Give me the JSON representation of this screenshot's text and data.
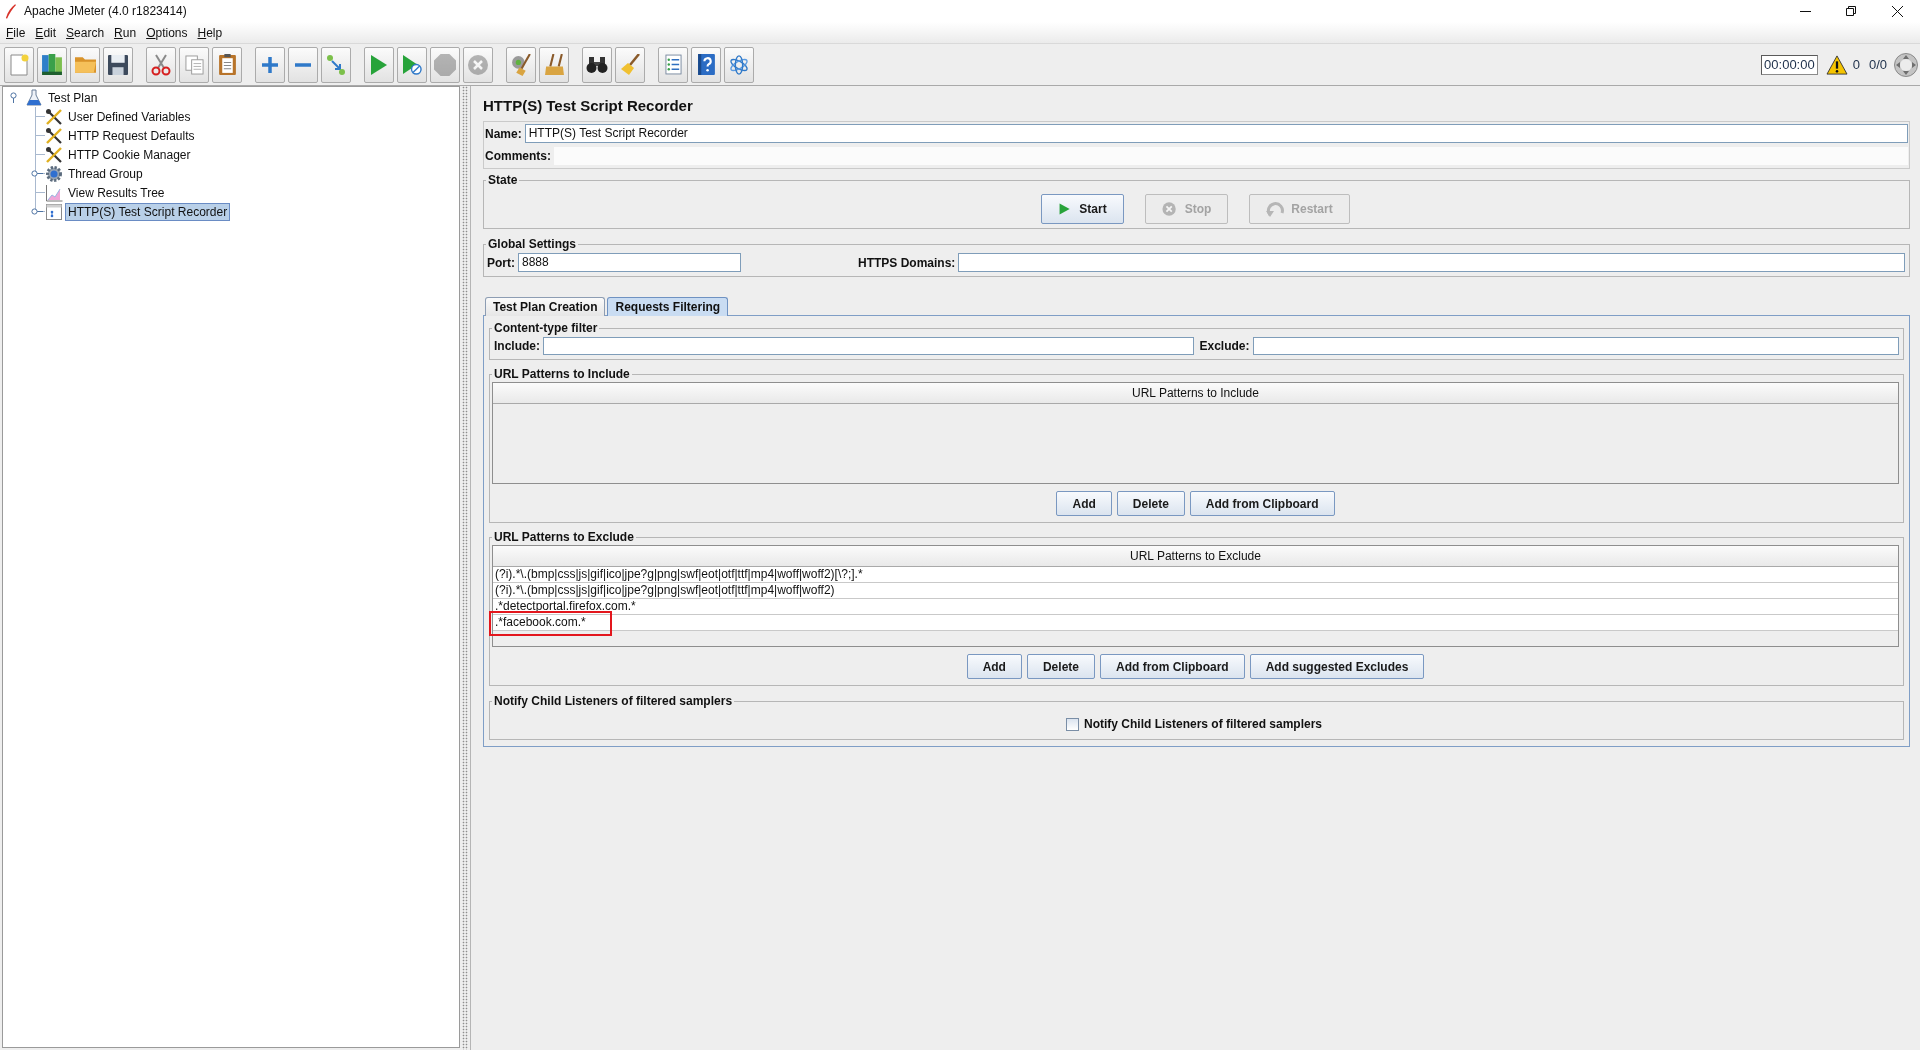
{
  "window": {
    "title": "Apache JMeter (4.0 r1823414)"
  },
  "menu": [
    "File",
    "Edit",
    "Search",
    "Run",
    "Options",
    "Help"
  ],
  "toolbar": {
    "groups": [
      [
        {
          "kind": "new",
          "disabled": false
        },
        {
          "kind": "templates",
          "disabled": false
        },
        {
          "kind": "open",
          "disabled": false
        },
        {
          "kind": "save",
          "disabled": false
        }
      ],
      [
        {
          "kind": "cut",
          "disabled": false
        },
        {
          "kind": "copy",
          "disabled": false
        },
        {
          "kind": "paste",
          "disabled": false
        }
      ],
      [
        {
          "kind": "expand",
          "disabled": false
        },
        {
          "kind": "collapse",
          "disabled": false
        },
        {
          "kind": "toggle",
          "disabled": false
        }
      ],
      [
        {
          "kind": "start",
          "disabled": false
        },
        {
          "kind": "start_no_pauses",
          "disabled": false
        },
        {
          "kind": "stop",
          "disabled": true
        },
        {
          "kind": "shutdown",
          "disabled": true
        }
      ],
      [
        {
          "kind": "clear",
          "disabled": false
        },
        {
          "kind": "clear_all",
          "disabled": false
        }
      ],
      [
        {
          "kind": "search",
          "disabled": false
        },
        {
          "kind": "reset_search",
          "disabled": false
        }
      ],
      [
        {
          "kind": "functions",
          "disabled": false
        },
        {
          "kind": "help",
          "disabled": false
        },
        {
          "kind": "log_viewer",
          "disabled": false
        }
      ]
    ],
    "timer": "00:00:00",
    "error_count": "0",
    "threads": "0/0"
  },
  "tree": {
    "items": [
      {
        "label": "Test Plan",
        "kind": "plan",
        "expanded": true,
        "selected": false,
        "children": [
          {
            "label": "User Defined Variables",
            "kind": "config",
            "selected": false
          },
          {
            "label": "HTTP Request Defaults",
            "kind": "config",
            "selected": false
          },
          {
            "label": "HTTP Cookie Manager",
            "kind": "config",
            "selected": false
          },
          {
            "label": "Thread Group",
            "kind": "thread_group",
            "expanded": false,
            "selected": false
          },
          {
            "label": "View Results Tree",
            "kind": "listener",
            "selected": false
          },
          {
            "label": "HTTP(S) Test Script Recorder",
            "kind": "recorder",
            "expanded": false,
            "selected": true
          }
        ]
      }
    ]
  },
  "editor": {
    "title": "HTTP(S) Test Script Recorder",
    "name": {
      "label": "Name:",
      "value": "HTTP(S) Test Script Recorder"
    },
    "comments": {
      "label": "Comments:"
    },
    "state": {
      "title": "State",
      "buttons": [
        {
          "kind": "start",
          "label": "Start",
          "disabled": false
        },
        {
          "kind": "stop",
          "label": "Stop",
          "disabled": true
        },
        {
          "kind": "restart",
          "label": "Restart",
          "disabled": true
        }
      ]
    },
    "global_settings": {
      "title": "Global Settings",
      "port": {
        "label": "Port:",
        "value": "8888"
      },
      "https_domains": {
        "label": "HTTPS Domains:"
      }
    },
    "tabs": [
      {
        "label": "Test Plan Creation",
        "selected": false
      },
      {
        "label": "Requests Filtering",
        "selected": true
      }
    ],
    "content_type_filter": {
      "title": "Content-type filter",
      "include": {
        "label": "Include:"
      },
      "exclude": {
        "label": "Exclude:"
      }
    },
    "url_include": {
      "title": "URL Patterns to Include",
      "column": "URL Patterns to Include",
      "buttons": [
        "Add",
        "Delete",
        "Add from Clipboard"
      ]
    },
    "url_exclude": {
      "title": "URL Patterns to Exclude",
      "column": "URL Patterns to Exclude",
      "rows": [
        {
          "pattern": "(?i).*\\.(bmp|css|js|gif|ico|jpe?g|png|swf|eot|otf|ttf|mp4|woff|woff2)[\\?;].*",
          "highlighted": false
        },
        {
          "pattern": "(?i).*\\.(bmp|css|js|gif|ico|jpe?g|png|swf|eot|otf|ttf|mp4|woff|woff2)",
          "highlighted": false
        },
        {
          "pattern": ".*detectportal.firefox.com.*",
          "highlighted": false
        },
        {
          "pattern": ".*facebook.com.*",
          "highlighted": true
        }
      ],
      "buttons": [
        "Add",
        "Delete",
        "Add from Clipboard",
        "Add suggested Excludes"
      ]
    },
    "notify": {
      "title": "Notify Child Listeners of filtered samplers",
      "checkbox": {
        "label": "Notify Child Listeners of filtered samplers",
        "checked": false
      }
    }
  }
}
